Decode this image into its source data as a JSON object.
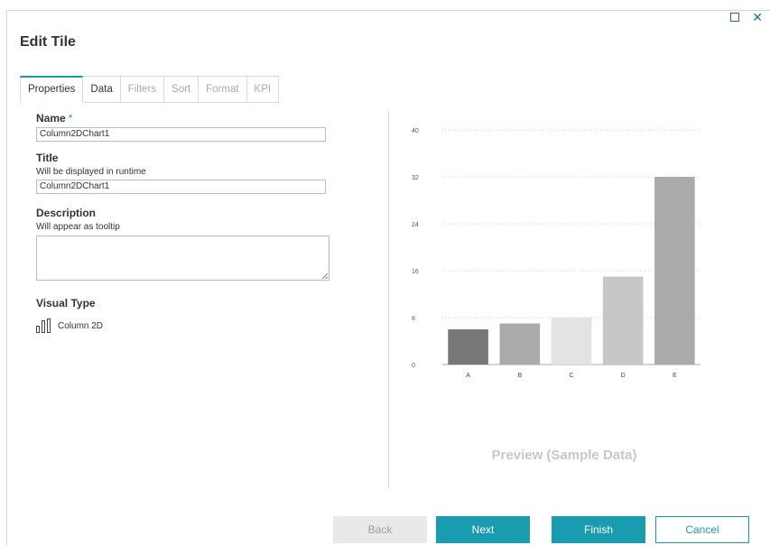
{
  "dialog": {
    "title": "Edit Tile",
    "maximize_icon": "maximize-icon",
    "close_icon": "close-icon"
  },
  "tabs": [
    {
      "label": "Properties",
      "state": "active"
    },
    {
      "label": "Data",
      "state": "enabled"
    },
    {
      "label": "Filters",
      "state": "disabled"
    },
    {
      "label": "Sort",
      "state": "disabled"
    },
    {
      "label": "Format",
      "state": "disabled"
    },
    {
      "label": "KPI",
      "state": "disabled"
    }
  ],
  "form": {
    "name_label": "Name",
    "required_mark": "*",
    "name_value": "Column2DChart1",
    "title_label": "Title",
    "title_hint": "Will be displayed in runtime",
    "title_value": "Column2DChart1",
    "description_label": "Description",
    "description_hint": "Will appear as tooltip",
    "description_value": "",
    "visual_type_label": "Visual Type",
    "visual_type_value": "Column 2D",
    "visual_type_icon": "column-chart-icon"
  },
  "preview": {
    "label": "Preview (Sample Data)"
  },
  "chart_data": {
    "type": "bar",
    "categories": [
      "A",
      "B",
      "C",
      "D",
      "E"
    ],
    "values": [
      6,
      7,
      8,
      15,
      32
    ],
    "colors": [
      "#777777",
      "#aaaaaa",
      "#e3e3e3",
      "#c6c6c6",
      "#aaaaaa"
    ],
    "y_ticks": [
      0,
      8,
      16,
      24,
      32,
      40
    ],
    "ylim": [
      0,
      40
    ],
    "grid": true
  },
  "buttons": {
    "back": "Back",
    "next": "Next",
    "finish": "Finish",
    "cancel": "Cancel"
  },
  "colors": {
    "accent": "#1a9cb0",
    "disabled_button": "#e7e9ea",
    "preview_text": "#c7c7c7"
  }
}
